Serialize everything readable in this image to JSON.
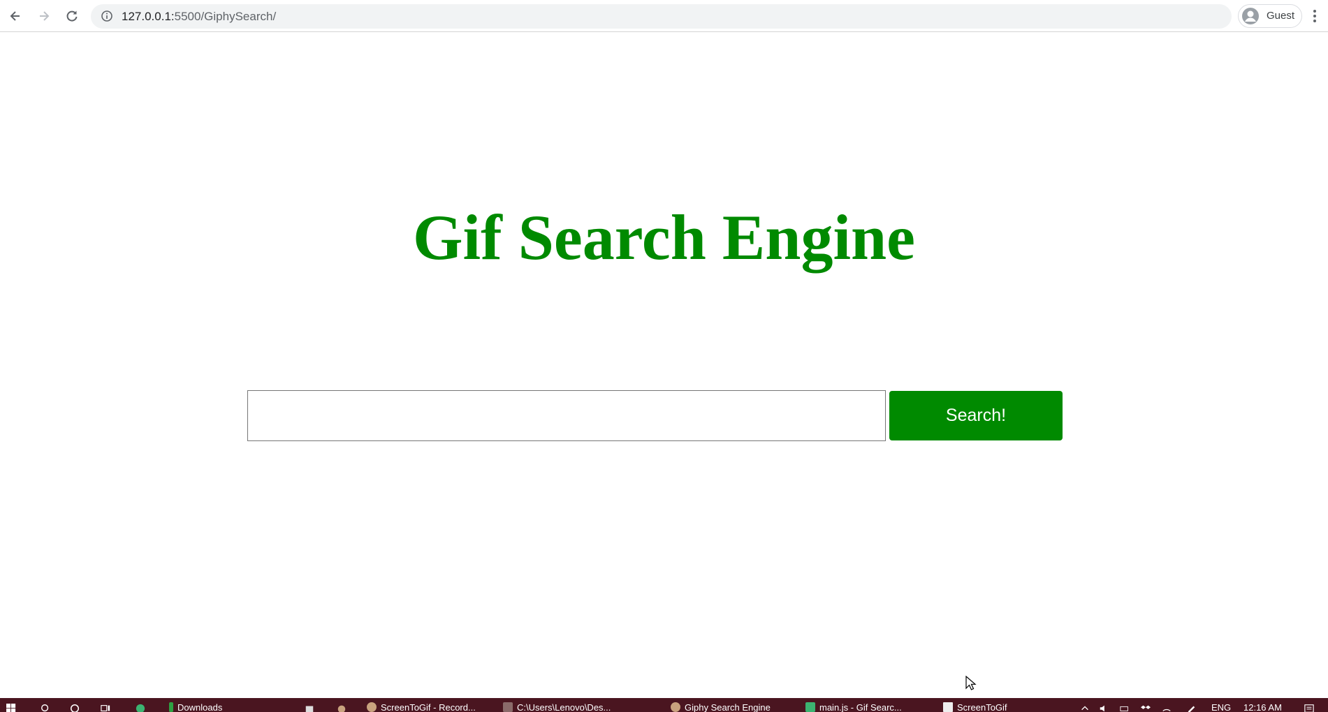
{
  "browser": {
    "url_host": "127.0.0.1:",
    "url_path": "5500/GiphySearch/",
    "profile_label": "Guest"
  },
  "page": {
    "title": "Gif Search Engine",
    "search_placeholder": "",
    "search_value": "",
    "search_button_label": "Search!"
  },
  "taskbar": {
    "items": [
      {
        "label": "Downloads",
        "icon": "folder-icon"
      },
      {
        "label": "ScreenToGif - Record...",
        "icon": "screentogif-icon"
      },
      {
        "label": "C:\\Users\\Lenovo\\Des...",
        "icon": "terminal-icon"
      },
      {
        "label": "Giphy Search Engine",
        "icon": "chrome-icon"
      },
      {
        "label": "main.js - Gif Searc...",
        "icon": "vscode-icon"
      },
      {
        "label": "ScreenToGif",
        "icon": "screentogif-icon"
      }
    ],
    "language": "ENG",
    "time": "12:16 AM"
  },
  "colors": {
    "accent": "#008a00",
    "taskbar": "#4a1520"
  }
}
